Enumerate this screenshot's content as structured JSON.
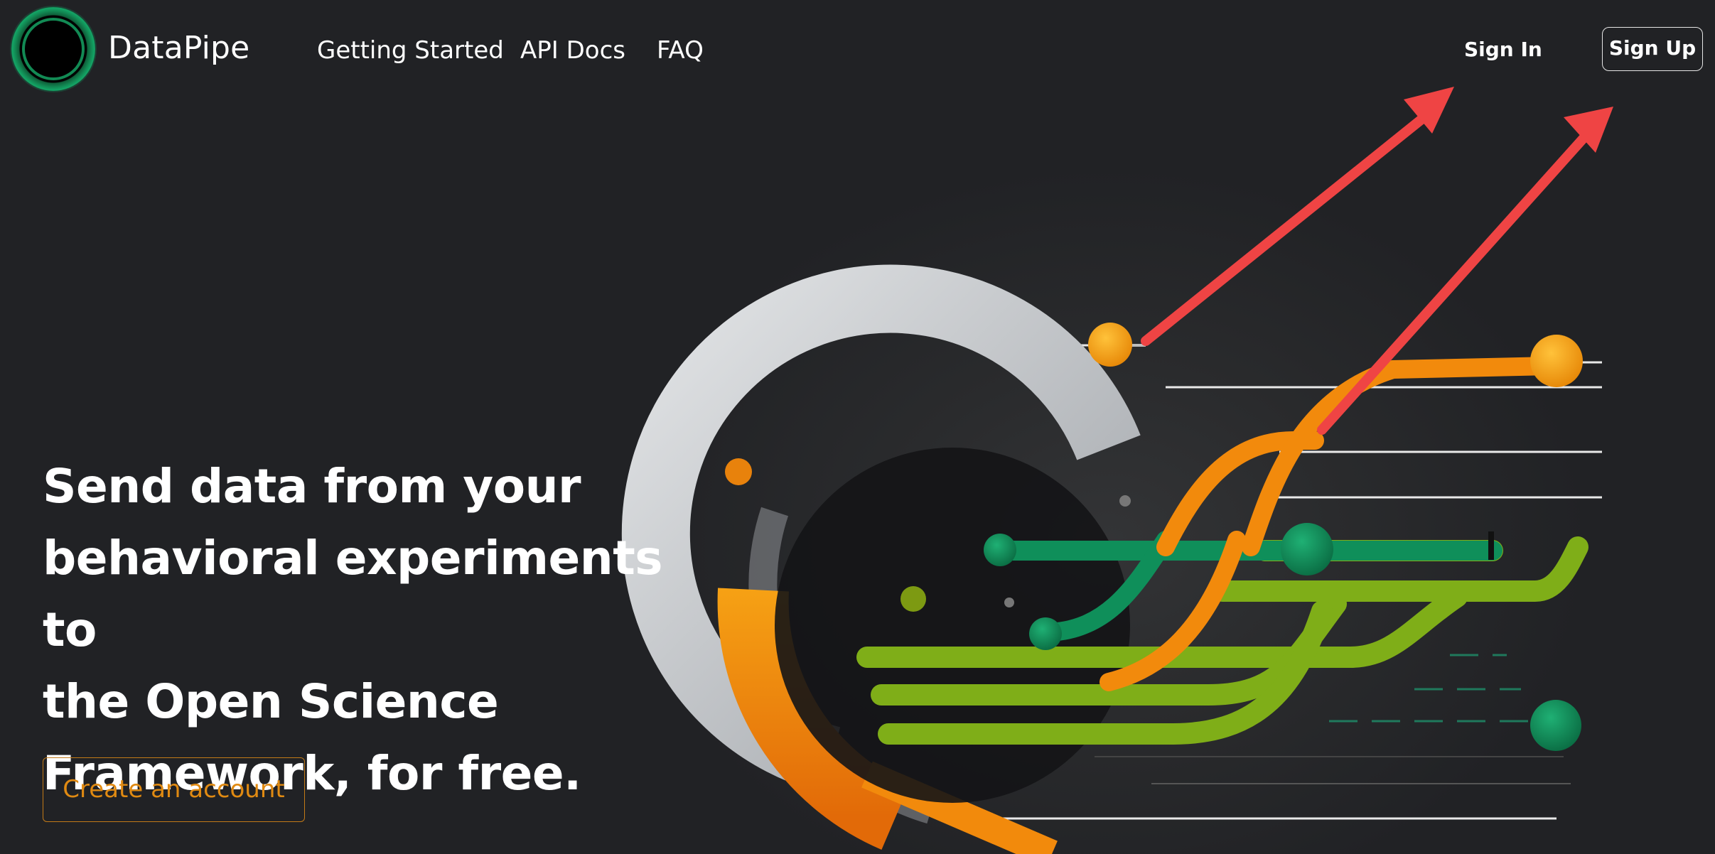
{
  "brand": {
    "name": "DataPipe",
    "logo_icon": "ring-logo-icon",
    "logo_color": "#128c55"
  },
  "nav": {
    "links": [
      {
        "label": "Getting Started"
      },
      {
        "label": "API Docs"
      },
      {
        "label": "FAQ"
      }
    ],
    "sign_in": "Sign In",
    "sign_up": "Sign Up"
  },
  "hero": {
    "title_lines": [
      "Send data from your",
      "behavioral experiments to",
      "the Open Science",
      "Framework, for free."
    ],
    "cta_label": "Create an account",
    "cta_color": "#e08a12"
  },
  "illustration": {
    "name": "data-pipeline-illustration",
    "annotation_arrows": [
      "arrow-to-sign-in-icon",
      "arrow-to-sign-up-icon"
    ],
    "colors": {
      "orange": "#f28a0c",
      "green": "#0f8f5a",
      "lime": "#7fae18",
      "silver": "#c9ccd0",
      "arrow_red": "#ef4444"
    }
  },
  "page": {
    "background": "#212225"
  }
}
